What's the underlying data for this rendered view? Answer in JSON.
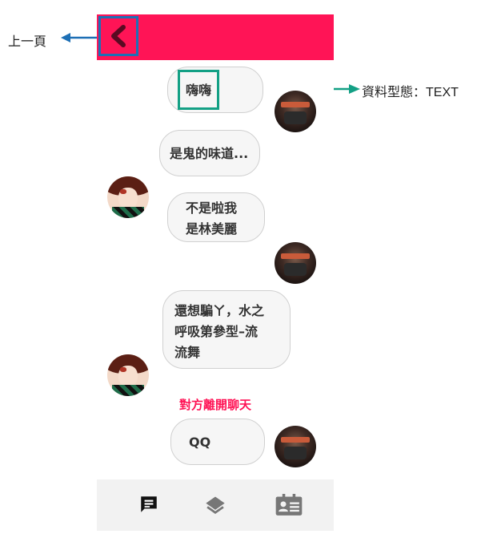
{
  "annotations": {
    "back_label": "上一頁",
    "data_type_label": "資料型態：TEXT"
  },
  "messages": [
    {
      "side": "right",
      "text": "嗨嗨"
    },
    {
      "side": "left",
      "text": "是鬼的味道..."
    },
    {
      "side": "left",
      "text": "不是啦我\n是林美麗"
    },
    {
      "side": "left",
      "text": "還想騙ㄚ，水之\n呼吸第參型–流\n流舞"
    },
    {
      "side": "right",
      "text": "QQ"
    }
  ],
  "system_message": "對方離開聊天",
  "colors": {
    "accent": "#ff1456",
    "annotation_blue": "#1d6fb5",
    "annotation_green": "#13a085",
    "bubble_bg": "#f6f6f6",
    "nav_bg": "#f2f2f2"
  },
  "nav": {
    "items": [
      {
        "icon": "chat-icon",
        "active": true
      },
      {
        "icon": "layers-icon",
        "active": false
      },
      {
        "icon": "contact-card-icon",
        "active": false
      }
    ]
  }
}
